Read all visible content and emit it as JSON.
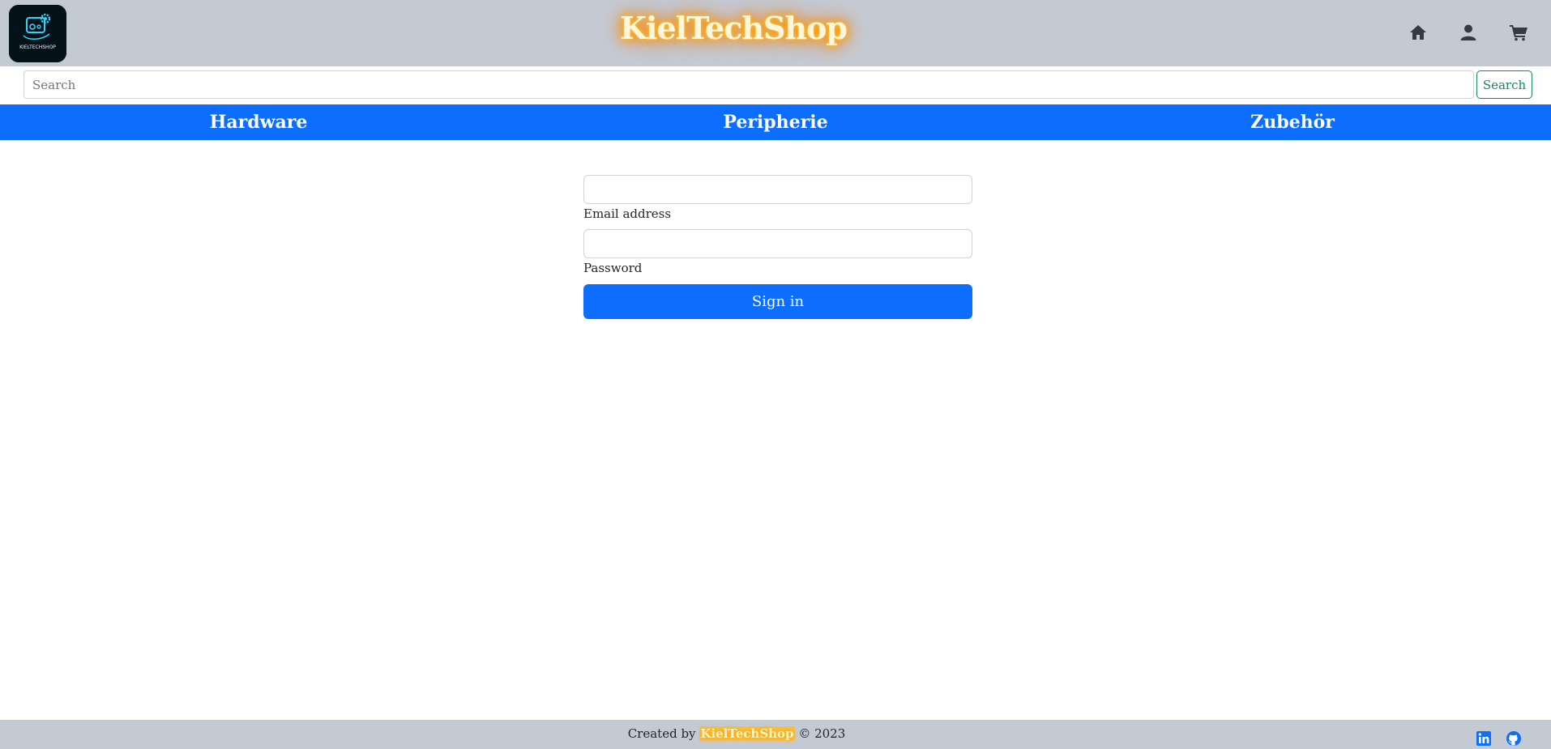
{
  "header": {
    "brand": "KielTechShop",
    "logo_text": "KIELTECHSHOP",
    "icons": [
      "home-icon",
      "user-icon",
      "cart-icon"
    ]
  },
  "search": {
    "placeholder": "Search",
    "button_label": "Search"
  },
  "categories": [
    {
      "label": "Hardware"
    },
    {
      "label": "Peripherie"
    },
    {
      "label": "Zubehör"
    }
  ],
  "login": {
    "email_label": "Email address",
    "email_value": "",
    "password_label": "Password",
    "password_value": "",
    "submit_label": "Sign in"
  },
  "footer": {
    "prefix": "Created by",
    "brand": "KielTechShop",
    "suffix": "© 2023",
    "icons": [
      "linkedin-icon",
      "github-icon"
    ]
  },
  "colors": {
    "header_bg": "#c4cad4",
    "primary": "#0d6efd",
    "search_button": "#198754",
    "brand_glow": "#ff9900"
  }
}
